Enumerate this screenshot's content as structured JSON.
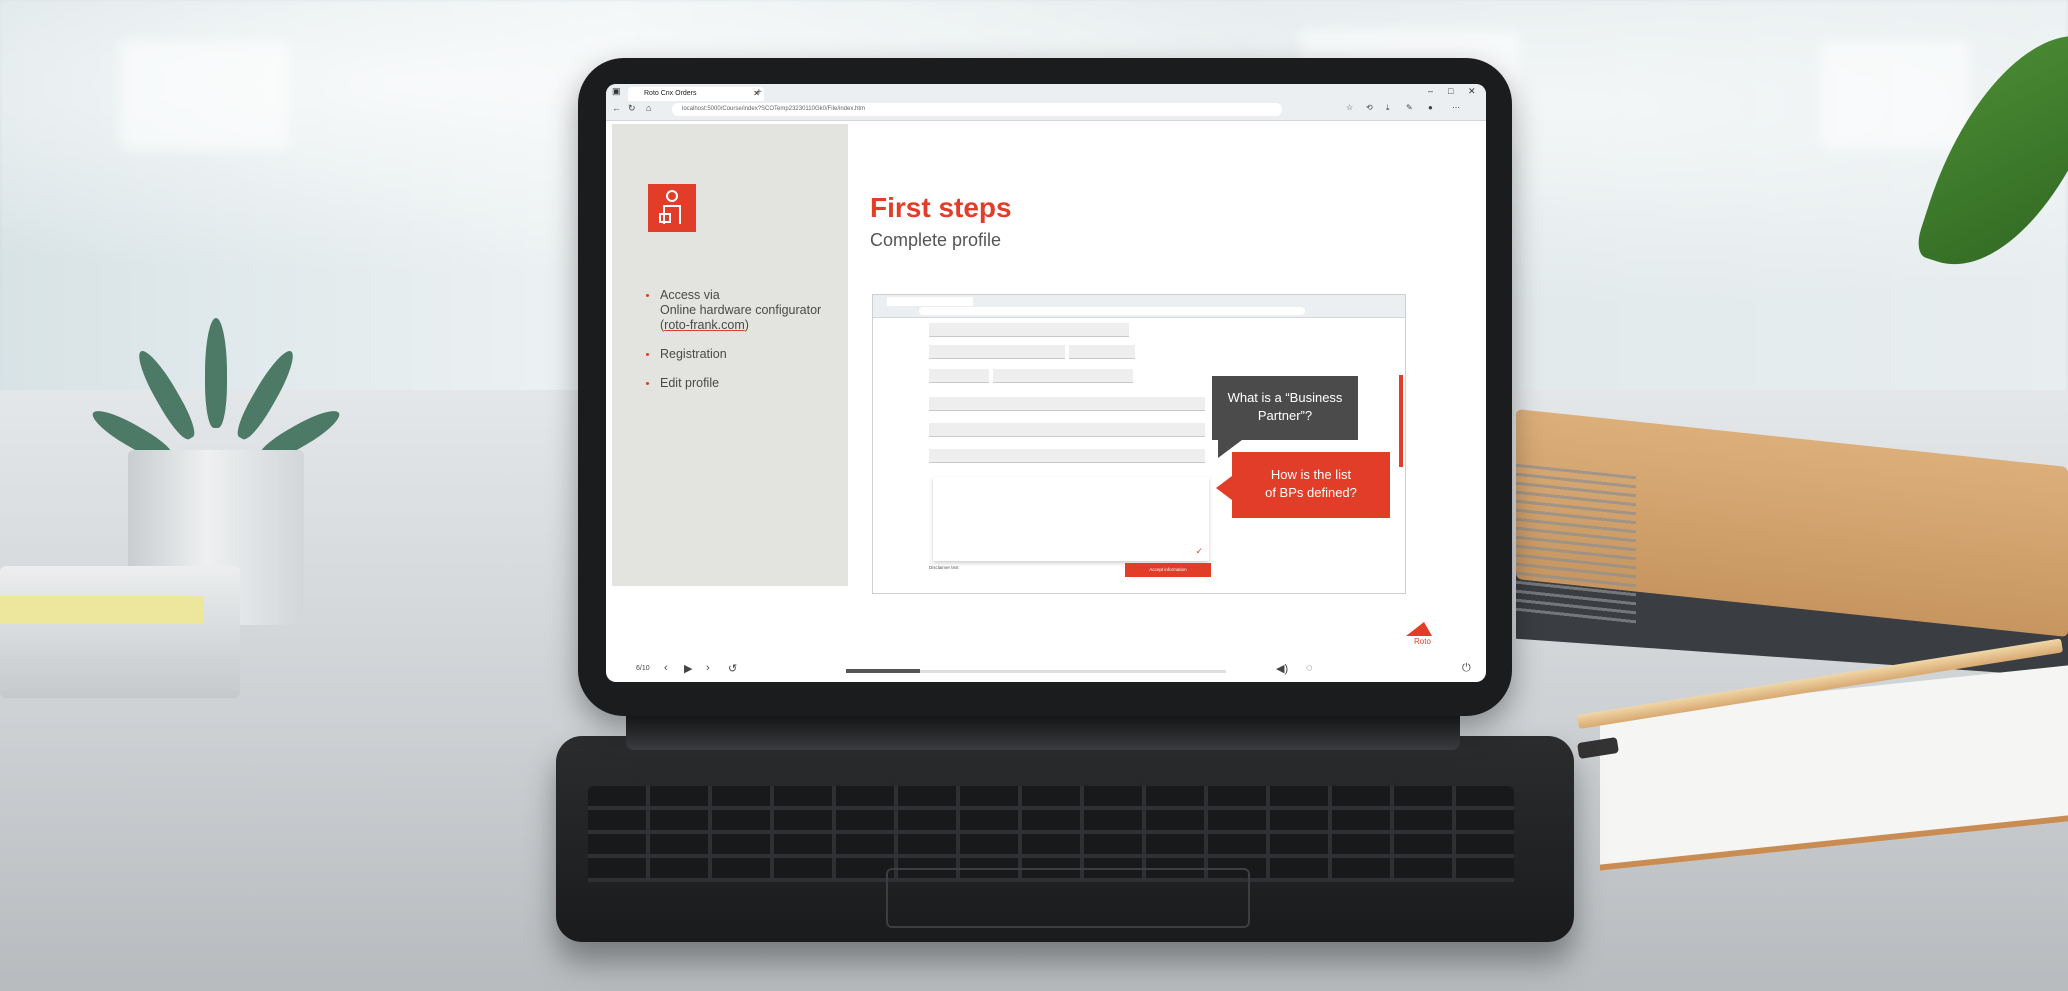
{
  "browser": {
    "tab_title": "Roto Cnx Orders",
    "url": "localhost:5000/Course/index?SCOTemp23230110Gk0/File/index.htm"
  },
  "slide": {
    "title": "First steps",
    "subtitle": "Complete profile",
    "bullets": [
      {
        "line1": "Access via",
        "line2": "Online hardware configurator",
        "link": "roto-frank.com"
      },
      {
        "line1": "Registration"
      },
      {
        "line1": "Edit profile"
      }
    ],
    "callouts": {
      "grey_line1": "What is a “Business",
      "grey_line2": "Partner”?",
      "red_line1": "How is the list",
      "red_line2": "of BPs defined?"
    },
    "embedded_form": {
      "accept_button": "Accept information",
      "terms_label": "Disclaimer text"
    },
    "logo_text": "Roto",
    "player": {
      "slide_counter": "6/10"
    }
  },
  "colors": {
    "accent": "#e23d28",
    "left_panel": "#e3e3e0",
    "callout_grey": "#4b4b4b"
  }
}
